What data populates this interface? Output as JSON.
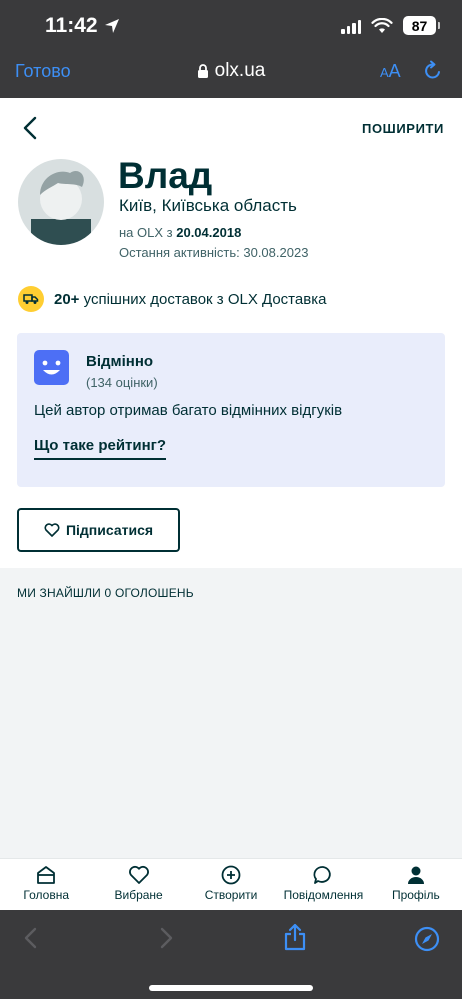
{
  "status_bar": {
    "time": "11:42",
    "battery": "87"
  },
  "browser": {
    "done_label": "Готово",
    "url": "olx.ua",
    "text_size_label_small": "A",
    "text_size_label_large": "A"
  },
  "header": {
    "share_label": "ПОШИРИТИ"
  },
  "profile": {
    "name": "Влад",
    "location": "Київ, Київська область",
    "since_prefix": "на OLX з",
    "since_date": "20.04.2018",
    "last_activity": "Остання активність: 30.08.2023"
  },
  "delivery": {
    "count": "20+",
    "text": " успішних доставок з OLX Доставка"
  },
  "rating": {
    "title": "Відмінно",
    "count": "(134 оцінки)",
    "description": "Цей автор отримав багато відмінних відгуків",
    "link": "Що таке рейтинг?"
  },
  "subscribe": {
    "label": "Підписатися"
  },
  "listings": {
    "title": "МИ ЗНАЙШЛИ 0 ОГОЛОШЕНЬ"
  },
  "bottom_nav": [
    {
      "label": "Головна",
      "icon": "home-icon"
    },
    {
      "label": "Вибране",
      "icon": "heart-icon"
    },
    {
      "label": "Створити",
      "icon": "plus-circle-icon"
    },
    {
      "label": "Повідомлення",
      "icon": "chat-icon"
    },
    {
      "label": "Профіль",
      "icon": "user-icon"
    }
  ],
  "colors": {
    "brand_dark": "#002f34",
    "rating_bg": "#e9edfb",
    "safari_blue": "#3d8ff5",
    "delivery_badge": "#ffce32"
  }
}
